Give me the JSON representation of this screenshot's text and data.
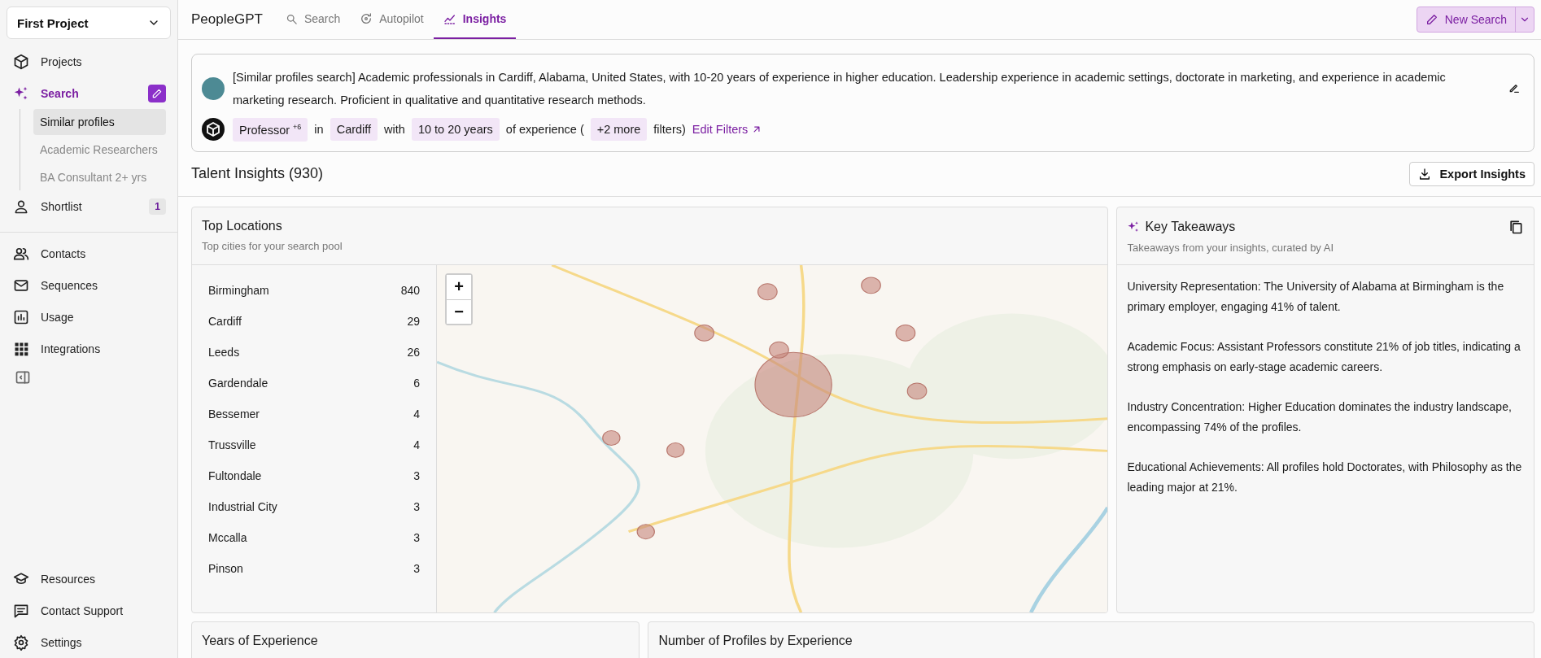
{
  "sidebar": {
    "project": "First Project",
    "items": [
      {
        "label": "Projects",
        "kind": "nav",
        "selected": false
      },
      {
        "label": "Search",
        "kind": "section",
        "selected": true,
        "children": [
          {
            "label": "Similar profiles",
            "selected": true
          },
          {
            "label": "Academic Researchers",
            "selected": false
          },
          {
            "label": "BA Consultant 2+ yrs",
            "selected": false
          }
        ]
      },
      {
        "label": "Shortlist",
        "kind": "nav",
        "selected": false,
        "badge": "1"
      }
    ],
    "tools": [
      {
        "label": "Contacts"
      },
      {
        "label": "Sequences"
      },
      {
        "label": "Usage"
      },
      {
        "label": "Integrations"
      }
    ],
    "footer": [
      {
        "label": "Resources"
      },
      {
        "label": "Contact Support"
      },
      {
        "label": "Settings"
      }
    ]
  },
  "header": {
    "title": "PeopleGPT",
    "tabs": [
      {
        "label": "Search",
        "selected": false
      },
      {
        "label": "Autopilot",
        "selected": false
      },
      {
        "label": "Insights",
        "selected": true
      }
    ],
    "new_search": "New Search"
  },
  "query": {
    "text": "[Similar profiles search] Academic professionals in Cardiff, Alabama, United States, with 10-20 years of experience in higher education. Leadership experience in academic settings, doctorate in marketing, and experience in academic marketing research. Proficient in qualitative and quantitative research methods.",
    "filters": [
      {
        "kind": "chip",
        "text": "Professor $^{+6}$"
      },
      {
        "kind": "text",
        "text": "in"
      },
      {
        "kind": "chip",
        "text": "Cardiff"
      },
      {
        "kind": "text",
        "text": "with"
      },
      {
        "kind": "chip",
        "text": "10 to 20 years"
      },
      {
        "kind": "text",
        "text": "of experience ("
      },
      {
        "kind": "chip",
        "text": "+2 more"
      },
      {
        "kind": "text",
        "text": "filters)"
      }
    ],
    "edit_link": "Edit Filters"
  },
  "insights": {
    "title": "Talent Insights (930)",
    "export": "Export Insights"
  },
  "locations": {
    "title": "Top Locations",
    "subtitle": "Top cities for your search pool",
    "rows": [
      {
        "city": "Birmingham",
        "count": "840"
      },
      {
        "city": "Cardiff",
        "count": "29"
      },
      {
        "city": "Leeds",
        "count": "26"
      },
      {
        "city": "Gardendale",
        "count": "6"
      },
      {
        "city": "Bessemer",
        "count": "4"
      },
      {
        "city": "Trussville",
        "count": "4"
      },
      {
        "city": "Fultondale",
        "count": "3"
      },
      {
        "city": "Industrial City",
        "count": "3"
      },
      {
        "city": "Mccalla",
        "count": "3"
      },
      {
        "city": "Pinson",
        "count": "3"
      }
    ],
    "map": {
      "kind": "picture",
      "zoom": [
        "+",
        "−"
      ]
    }
  },
  "takeaways": {
    "title": "Key Takeaways",
    "subtitle": "Takeaways from your insights, curated by AI",
    "items": [
      "University Representation: The University of Alabama at Birmingham is the primary employer, engaging 41% of talent.",
      "Academic Focus: Assistant Professors constitute 21% of job titles, indicating a strong emphasis on early-stage academic careers.",
      "Industry Concentration: Higher Education dominates the industry landscape, encompassing 74% of the profiles.",
      "Educational Achievements: All profiles hold Doctorates, with Philosophy as the leading major at 21%."
    ]
  },
  "bottom_cards": [
    "Years of Experience",
    "Number of Profiles by Experience"
  ]
}
